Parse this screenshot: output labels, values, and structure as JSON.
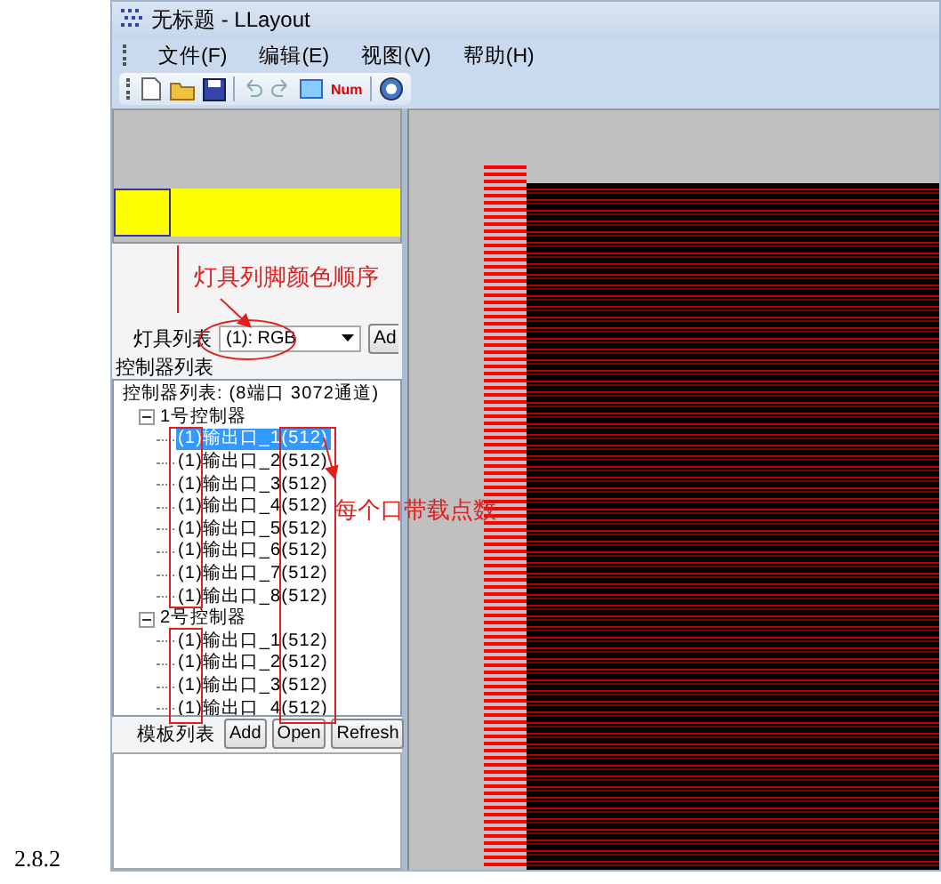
{
  "caption": "2.8.2",
  "window": {
    "title": "无标题 - LLayout"
  },
  "menu": [
    {
      "label": "文件(F)"
    },
    {
      "label": "编辑(E)"
    },
    {
      "label": "视图(V)"
    },
    {
      "label": "帮助(H)"
    }
  ],
  "toolbar": {
    "num_label": "Num"
  },
  "light_list": {
    "label": "灯具列表",
    "value": "(1): RGB",
    "button": "Ad"
  },
  "controller_list": {
    "label": "控制器列表",
    "tree": [
      {
        "label": "控制器列表: (8端口 3072通道)",
        "selected": false,
        "children": [
          {
            "label": "1号控制器",
            "expanded": true,
            "selected": false,
            "children": [
              {
                "label": "(1)输出口_1(512)",
                "selected": true
              },
              {
                "label": "(1)输出口_2(512)",
                "selected": false
              },
              {
                "label": "(1)输出口_3(512)",
                "selected": false
              },
              {
                "label": "(1)输出口_4(512)",
                "selected": false
              },
              {
                "label": "(1)输出口_5(512)",
                "selected": false
              },
              {
                "label": "(1)输出口_6(512)",
                "selected": false
              },
              {
                "label": "(1)输出口_7(512)",
                "selected": false
              },
              {
                "label": "(1)输出口_8(512)",
                "selected": false
              }
            ]
          },
          {
            "label": "2号控制器",
            "expanded": true,
            "selected": false,
            "children": [
              {
                "label": "(1)输出口_1(512)",
                "selected": false
              },
              {
                "label": "(1)输出口_2(512)",
                "selected": false
              },
              {
                "label": "(1)输出口_3(512)",
                "selected": false
              },
              {
                "label": "(1)输出口_4(512)",
                "selected": false
              }
            ]
          }
        ]
      }
    ]
  },
  "template_list": {
    "label": "模板列表",
    "buttons": [
      "Add",
      "Open",
      "Refresh"
    ]
  },
  "annotations": [
    {
      "kind": "pin-order",
      "text": "灯具列脚颜色顺序"
    },
    {
      "kind": "port-load",
      "text": "每个口带载点数"
    }
  ]
}
